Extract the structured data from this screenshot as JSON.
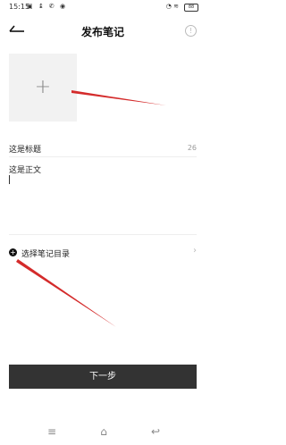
{
  "status_bar": {
    "time": "15:15",
    "battery": "88"
  },
  "header": {
    "title": "发布笔记"
  },
  "form": {
    "title_value": "这是标题",
    "title_count": "26",
    "body_value": "这是正文"
  },
  "catalog": {
    "label": "选择笔记目录"
  },
  "footer": {
    "next_label": "下一步"
  },
  "icons": {
    "back": "arrow-left-icon",
    "info": "info-icon",
    "add_image": "plus-icon",
    "catalog": "plus-circle-icon",
    "chevron": "chevron-right-icon"
  },
  "colors": {
    "annotation_arrow": "#d42b2b",
    "primary_button": "#333333",
    "upload_bg": "#f2f2f2"
  }
}
